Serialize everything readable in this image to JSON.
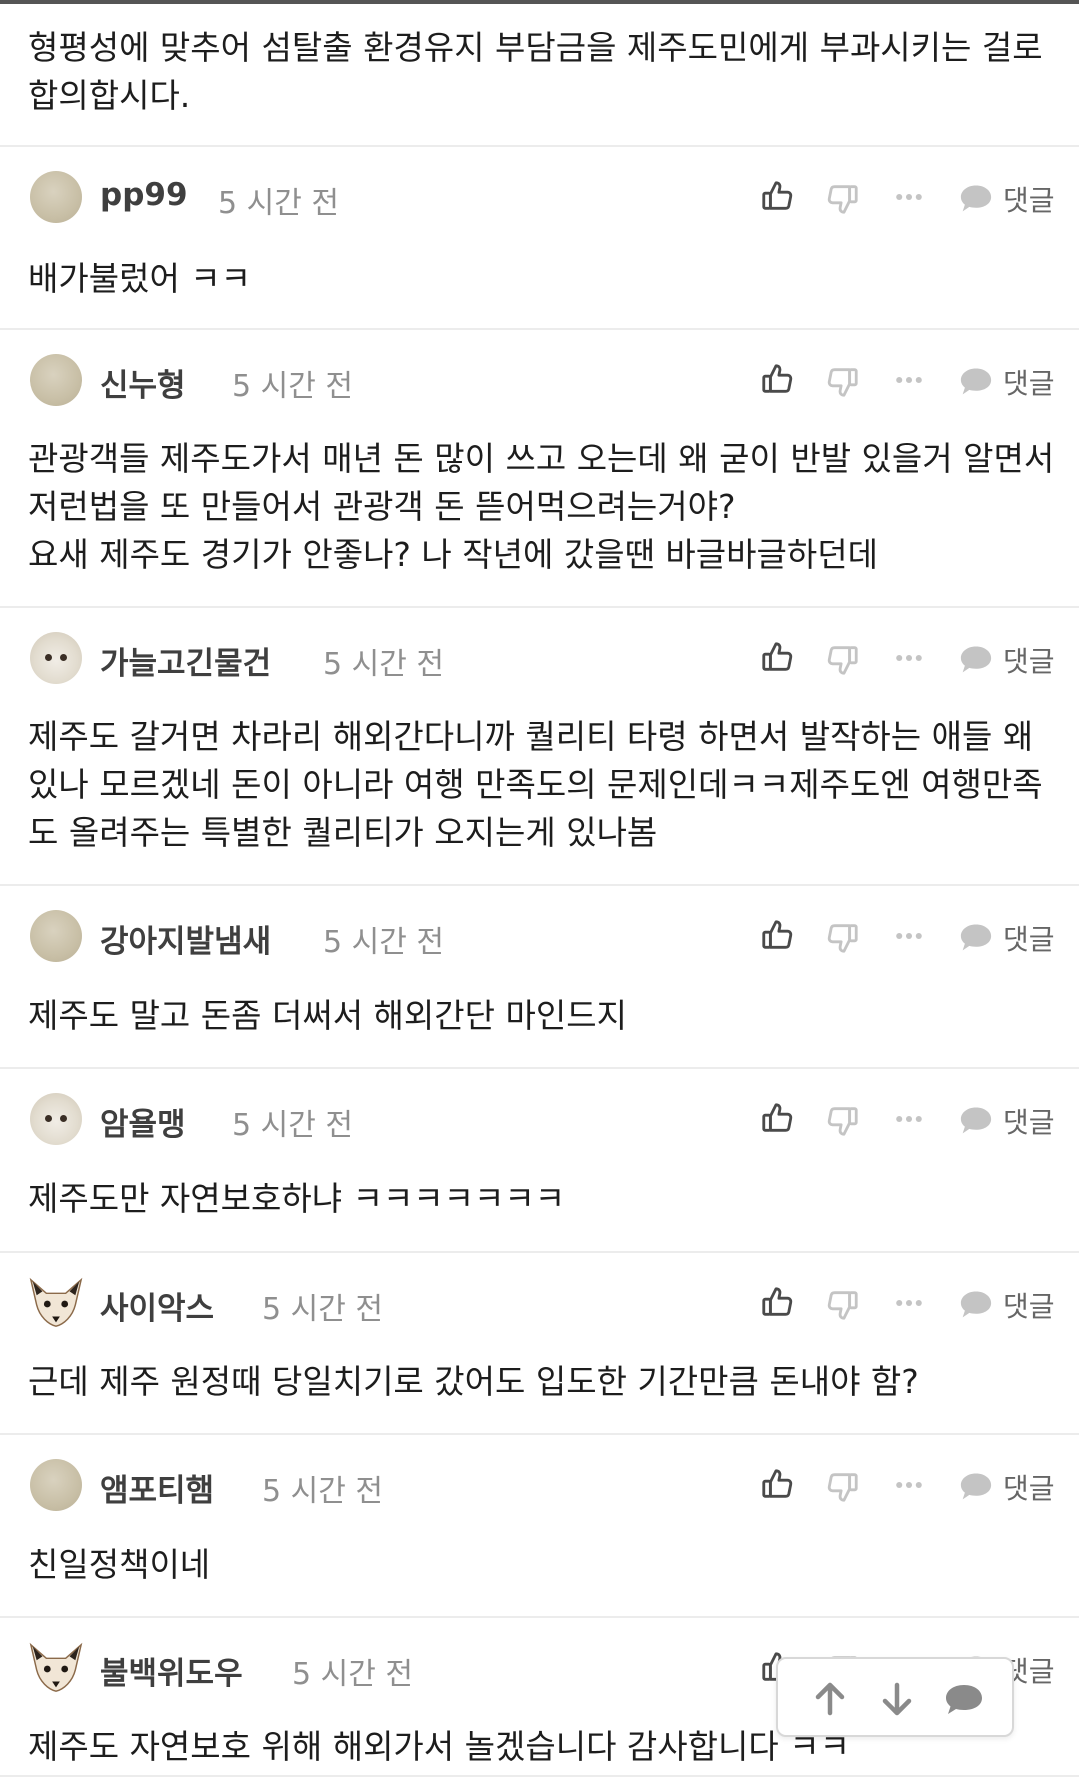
{
  "intro_text": "형평성에 맞추어 섬탈출 환경유지 부담금을 제주도민에게 부과시키는 걸로 합의합시다.",
  "reply_label": "댓글",
  "comments": [
    {
      "user": "pp99",
      "time": "5 시간 전",
      "avatar": "plain",
      "text": "배가불렀어 ㅋㅋ"
    },
    {
      "user": "신누형",
      "time": "5 시간 전",
      "avatar": "plain",
      "text": "관광객들 제주도가서 매년 돈 많이 쓰고 오는데 왜 굳이 반발 있을거 알면서 저런법을 또 만들어서 관광객 돈 뜯어먹으려는거야?\n요새 제주도 경기가 안좋나? 나 작년에 갔을땐 바글바글하던데"
    },
    {
      "user": "가늘고긴물건",
      "time": "5 시간 전",
      "avatar": "puppy",
      "text": "제주도 갈거면 차라리 해외간다니까 퀄리티 타령 하면서 발작하는 애들 왜 있나 모르겠네 돈이 아니라 여행 만족도의 문제인데ㅋㅋ제주도엔 여행만족도 올려주는 특별한 퀄리티가 오지는게 있나봄"
    },
    {
      "user": "강아지발냄새",
      "time": "5 시간 전",
      "avatar": "plain",
      "text": "제주도 말고 돈좀 더써서 해외간단 마인드지"
    },
    {
      "user": "암욜맹",
      "time": "5 시간 전",
      "avatar": "puppy",
      "text": "제주도만 자연보호하냐 ㅋㅋㅋㅋㅋㅋㅋ"
    },
    {
      "user": "사이악스",
      "time": "5 시간 전",
      "avatar": "fox",
      "text": "근데 제주 원정때 당일치기로 갔어도 입도한 기간만큼 돈내야 함?"
    },
    {
      "user": "앰포티햄",
      "time": "5 시간 전",
      "avatar": "plain",
      "text": "친일정책이네"
    },
    {
      "user": "불백위도우",
      "time": "5 시간 전",
      "avatar": "fox",
      "text": "제주도 자연보호 위해 해외가서 놀겠습니다 감사합니다 ㅋㅋ"
    }
  ],
  "icons": {
    "like": "thumbs-up-icon",
    "dislike": "thumbs-down-icon",
    "more": "more-dots-icon",
    "reply": "speech-bubble-icon",
    "scroll_up": "arrow-up-icon",
    "scroll_down": "arrow-down-icon",
    "float_comment": "speech-bubble-icon"
  },
  "colors": {
    "icon_dark": "#4a4a4a",
    "icon_light": "#c4c4c4",
    "divider": "#ececec",
    "time": "#8f8f8f"
  }
}
